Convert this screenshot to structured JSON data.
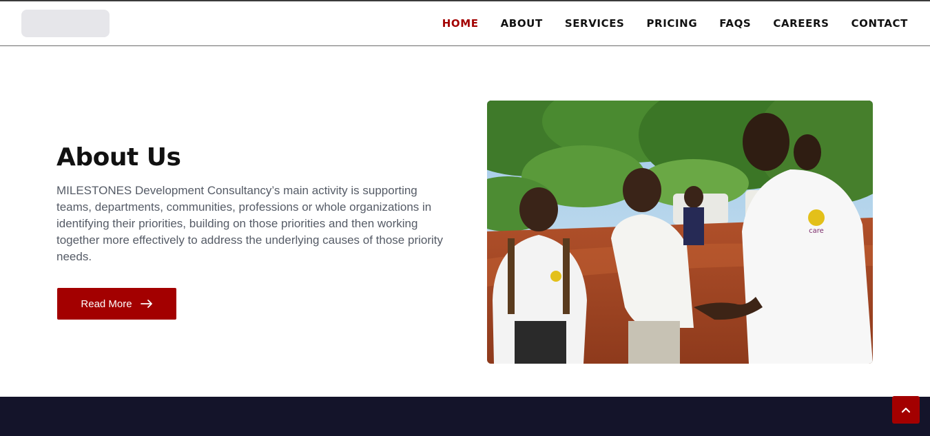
{
  "nav": {
    "items": [
      {
        "label": "HOME",
        "active": true
      },
      {
        "label": "ABOUT",
        "active": false
      },
      {
        "label": "SERVICES",
        "active": false
      },
      {
        "label": "PRICING",
        "active": false
      },
      {
        "label": "FAQS",
        "active": false
      },
      {
        "label": "CAREERS",
        "active": false
      },
      {
        "label": "CONTACT",
        "active": false
      }
    ]
  },
  "about": {
    "title": "About Us",
    "text": "MILESTONES Development Consultancy’s main activity is supporting teams, departments, communities, professions or whole organizations in identifying their priorities, building on those priorities and then working together more effectively to address the underlying causes of those priority needs.",
    "button_label": "Read More",
    "button_icon": "arrow-right-icon"
  },
  "photo": {
    "shirt_logo_text": "care"
  },
  "back_to_top": {
    "icon": "chevron-up-icon"
  },
  "colors": {
    "accent": "#a30000",
    "footer": "#14142a",
    "text_muted": "#555b66"
  }
}
